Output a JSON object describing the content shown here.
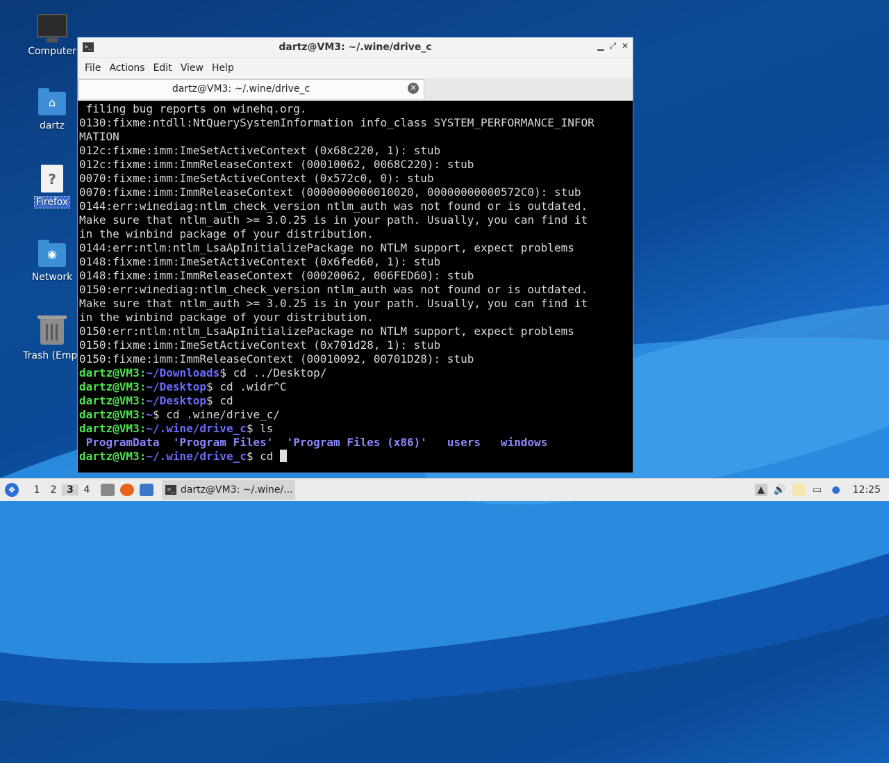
{
  "desktop": {
    "icons": [
      {
        "label": "Computer",
        "icon": "computer-icon"
      },
      {
        "label": "dartz",
        "icon": "home-folder-icon"
      },
      {
        "label": "Firefox",
        "icon": "unknown-file-icon",
        "selected": true
      },
      {
        "label": "Network",
        "icon": "network-folder-icon"
      },
      {
        "label": "Trash (Empt",
        "icon": "trash-icon"
      }
    ]
  },
  "window": {
    "title": "dartz@VM3: ~/.wine/drive_c",
    "menu": [
      "File",
      "Actions",
      "Edit",
      "View",
      "Help"
    ],
    "tab_label": "dartz@VM3: ~/.wine/drive_c"
  },
  "terminal": {
    "output_lines": [
      " filing bug reports on winehq.org.",
      "0130:fixme:ntdll:NtQuerySystemInformation info_class SYSTEM_PERFORMANCE_INFOR",
      "MATION",
      "012c:fixme:imm:ImeSetActiveContext (0x68c220, 1): stub",
      "012c:fixme:imm:ImmReleaseContext (00010062, 0068C220): stub",
      "0070:fixme:imm:ImeSetActiveContext (0x572c0, 0): stub",
      "0070:fixme:imm:ImmReleaseContext (0000000000010020, 00000000000572C0): stub",
      "0144:err:winediag:ntlm_check_version ntlm_auth was not found or is outdated.",
      "Make sure that ntlm_auth >= 3.0.25 is in your path. Usually, you can find it",
      "in the winbind package of your distribution.",
      "0144:err:ntlm:ntlm_LsaApInitializePackage no NTLM support, expect problems",
      "0148:fixme:imm:ImeSetActiveContext (0x6fed60, 1): stub",
      "0148:fixme:imm:ImmReleaseContext (00020062, 006FED60): stub",
      "0150:err:winediag:ntlm_check_version ntlm_auth was not found or is outdated.",
      "Make sure that ntlm_auth >= 3.0.25 is in your path. Usually, you can find it",
      "in the winbind package of your distribution.",
      "0150:err:ntlm:ntlm_LsaApInitializePackage no NTLM support, expect problems",
      "0150:fixme:imm:ImeSetActiveContext (0x701d28, 1): stub",
      "0150:fixme:imm:ImmReleaseContext (00010092, 00701D28): stub"
    ],
    "prompt_user": "dartz@VM3",
    "prompt_lines": [
      {
        "path": "~/Downloads",
        "cmd": " cd ../Desktop/"
      },
      {
        "path": "~/Desktop",
        "cmd": " cd .widr^C"
      },
      {
        "path": "~/Desktop",
        "cmd": " cd"
      },
      {
        "path": "~",
        "cmd": " cd .wine/drive_c/"
      },
      {
        "path": "~/.wine/drive_c",
        "cmd": " ls"
      }
    ],
    "ls_output": [
      " ProgramData",
      "  'Program Files'",
      "  'Program Files (x86)'",
      "   users",
      "   windows"
    ],
    "current": {
      "path": "~/.wine/drive_c",
      "cmd": " cd "
    }
  },
  "taskbar": {
    "workspaces": [
      "1",
      "2",
      "3",
      "4"
    ],
    "active_workspace": "3",
    "task_label": "dartz@VM3: ~/.wine/...",
    "clock": "12:25"
  }
}
